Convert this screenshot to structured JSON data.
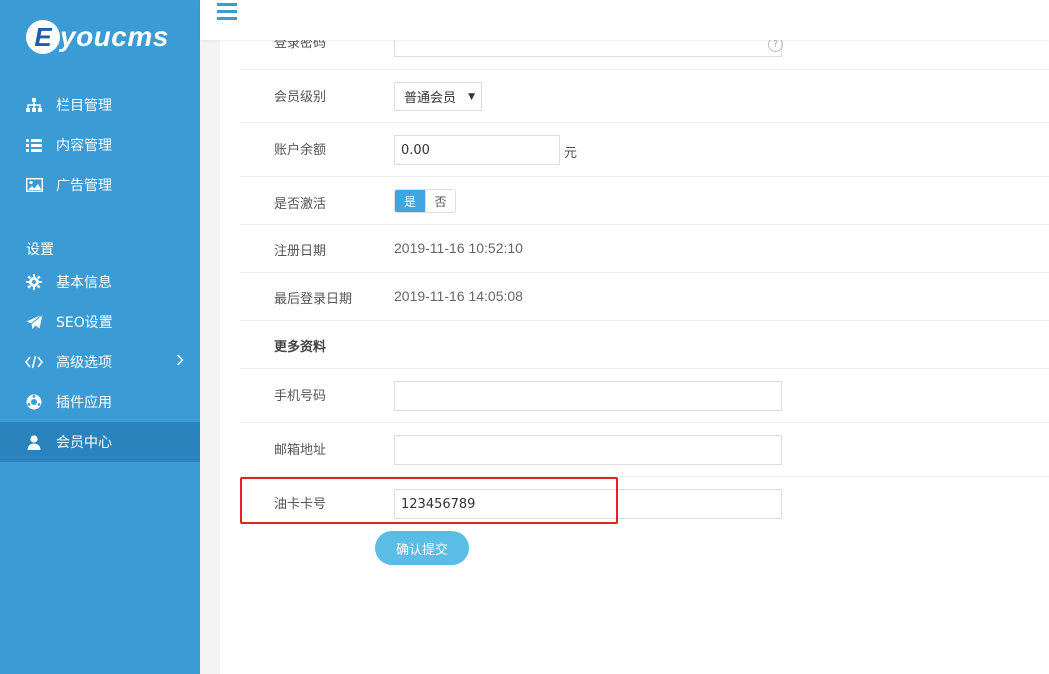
{
  "sidebar": {
    "logo_letter": "E",
    "logo_text": "youcms",
    "nav_top": [
      {
        "label": "栏目管理",
        "icon": "sitemap-icon"
      },
      {
        "label": "内容管理",
        "icon": "list-icon"
      },
      {
        "label": "广告管理",
        "icon": "image-icon"
      }
    ],
    "section_label": "设置",
    "nav_settings": [
      {
        "label": "基本信息",
        "icon": "gear-icon"
      },
      {
        "label": "SEO设置",
        "icon": "paper-plane-icon"
      },
      {
        "label": "高级选项",
        "icon": "code-icon",
        "arrow": "›"
      },
      {
        "label": "插件应用",
        "icon": "puzzle-icon"
      },
      {
        "label": "会员中心",
        "icon": "user-icon",
        "active": true
      }
    ]
  },
  "form": {
    "password_label": "登录密码",
    "password_value": "",
    "help_glyph": "?",
    "level_label": "会员级别",
    "level_selected": "普通会员",
    "balance_label": "账户余额",
    "balance_value": "0.00",
    "balance_unit": "元",
    "active_label": "是否激活",
    "active_yes": "是",
    "active_no": "否",
    "reg_date_label": "注册日期",
    "reg_date_value": "2019-11-16 10:52:10",
    "last_login_label": "最后登录日期",
    "last_login_value": "2019-11-16 14:05:08",
    "more_label": "更多资料",
    "phone_label": "手机号码",
    "phone_value": "",
    "email_label": "邮箱地址",
    "email_value": "",
    "card_label": "油卡卡号",
    "card_value": "123456789",
    "submit_label": "确认提交"
  },
  "colors": {
    "sidebar": "#3b9bd4",
    "sidebar_active": "#2a83bd",
    "accent": "#41a6df",
    "submit": "#5bbde6",
    "highlight": "#e42222"
  }
}
